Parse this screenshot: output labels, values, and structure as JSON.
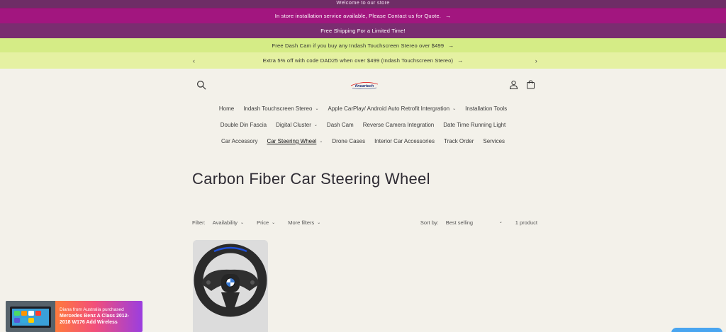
{
  "announcements": {
    "welcome": "Welcome to our store",
    "installation": "In store installation service available, Please Contact us for Quote.",
    "shipping": "Free Shipping For a Limited Time!",
    "dashcam": "Free Dash Cam if you buy any Indash Touchscreen Stereo over $499",
    "discount": "Extra 5% off with code DAD25 when over $499 (Indash Touchscreen Stereo)",
    "arrow": "→",
    "prev": "‹",
    "next": "›"
  },
  "header": {
    "logo_text": "fineartech"
  },
  "nav": {
    "row1": [
      {
        "label": "Home",
        "dropdown": false
      },
      {
        "label": "Indash Touchscreen Stereo",
        "dropdown": true
      },
      {
        "label": "Apple CarPlay/ Android Auto Retrofit Intergration",
        "dropdown": true
      },
      {
        "label": "Installation Tools",
        "dropdown": false
      }
    ],
    "row2": [
      {
        "label": "Double Din Fascia",
        "dropdown": false
      },
      {
        "label": "Digital Cluster",
        "dropdown": true
      },
      {
        "label": "Dash Cam",
        "dropdown": false
      },
      {
        "label": "Reverse Camera Integration",
        "dropdown": false
      },
      {
        "label": "Date Time Running Light",
        "dropdown": false
      }
    ],
    "row3": [
      {
        "label": "Car Accessory",
        "dropdown": false
      },
      {
        "label": "Car Steering Wheel",
        "dropdown": true,
        "active": true
      },
      {
        "label": "Drone Cases",
        "dropdown": false
      },
      {
        "label": "Interior Car Accessories",
        "dropdown": false
      },
      {
        "label": "Track Order",
        "dropdown": false
      },
      {
        "label": "Services",
        "dropdown": false
      }
    ]
  },
  "collection": {
    "title": "Carbon Fiber Car Steering Wheel"
  },
  "filters": {
    "label": "Filter:",
    "availability": "Availability",
    "price": "Price",
    "more": "More filters",
    "sort_label": "Sort by:",
    "sort_value": "Best selling",
    "count": "1 product"
  },
  "popup": {
    "line1": "Diana from Australia purchased",
    "line2": "Mercedes Benz A Class 2012-",
    "line3": "2018 W176 Add Wireless"
  },
  "colors": {
    "bar_welcome": "#6e2d66",
    "bar_installation": "#a2167f",
    "bar_shipping": "#7a2d70",
    "bar_dashcam": "#d5ec86",
    "bar_discount": "#e5f1a2",
    "page_bg": "#f3f1ea",
    "chat_button": "#49a5f0"
  }
}
